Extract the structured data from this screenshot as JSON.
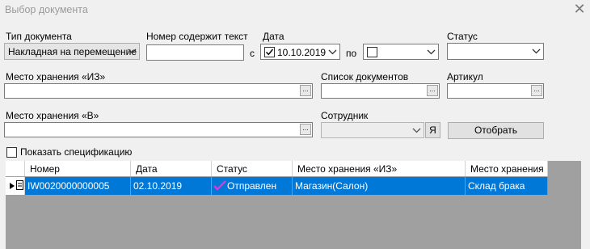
{
  "window": {
    "title": "Выбор документа"
  },
  "filters": {
    "doc_type_label": "Тип документа",
    "doc_type_value": "Накладная на перемещение",
    "number_label": "Номер содержит текст",
    "number_value": "",
    "date_label": "Дата",
    "date_from_prefix": "с",
    "date_from_value": "10.10.2019",
    "date_from_checked": true,
    "date_to_prefix": "по",
    "date_to_value": "",
    "date_to_checked": false,
    "status_label": "Статус",
    "status_value": "",
    "from_label": "Место хранения «ИЗ»",
    "from_value": "",
    "doclist_label": "Список документов",
    "doclist_value": "",
    "article_label": "Артикул",
    "article_value": "",
    "to_label": "Место хранения «В»",
    "to_value": "",
    "employee_label": "Сотрудник",
    "employee_value": "",
    "employee_btn": "Я",
    "select_btn": "Отобрать",
    "show_spec_label": "Показать спецификацию",
    "show_spec_checked": false,
    "ellipsis": "..."
  },
  "grid": {
    "columns": [
      "Номер",
      "Дата",
      "Статус",
      "Место хранения «ИЗ»",
      "Место хранения"
    ],
    "rows": [
      {
        "number": "IW0020000000005",
        "date": "02.10.2019",
        "status": "Отправлен",
        "from": "Магазин(Салон)",
        "to": "Склад брака",
        "selected": true
      }
    ]
  },
  "colors": {
    "selection": "#0078d7",
    "grid_bg": "#a0a0a0",
    "status_check": "#d63bd6"
  }
}
